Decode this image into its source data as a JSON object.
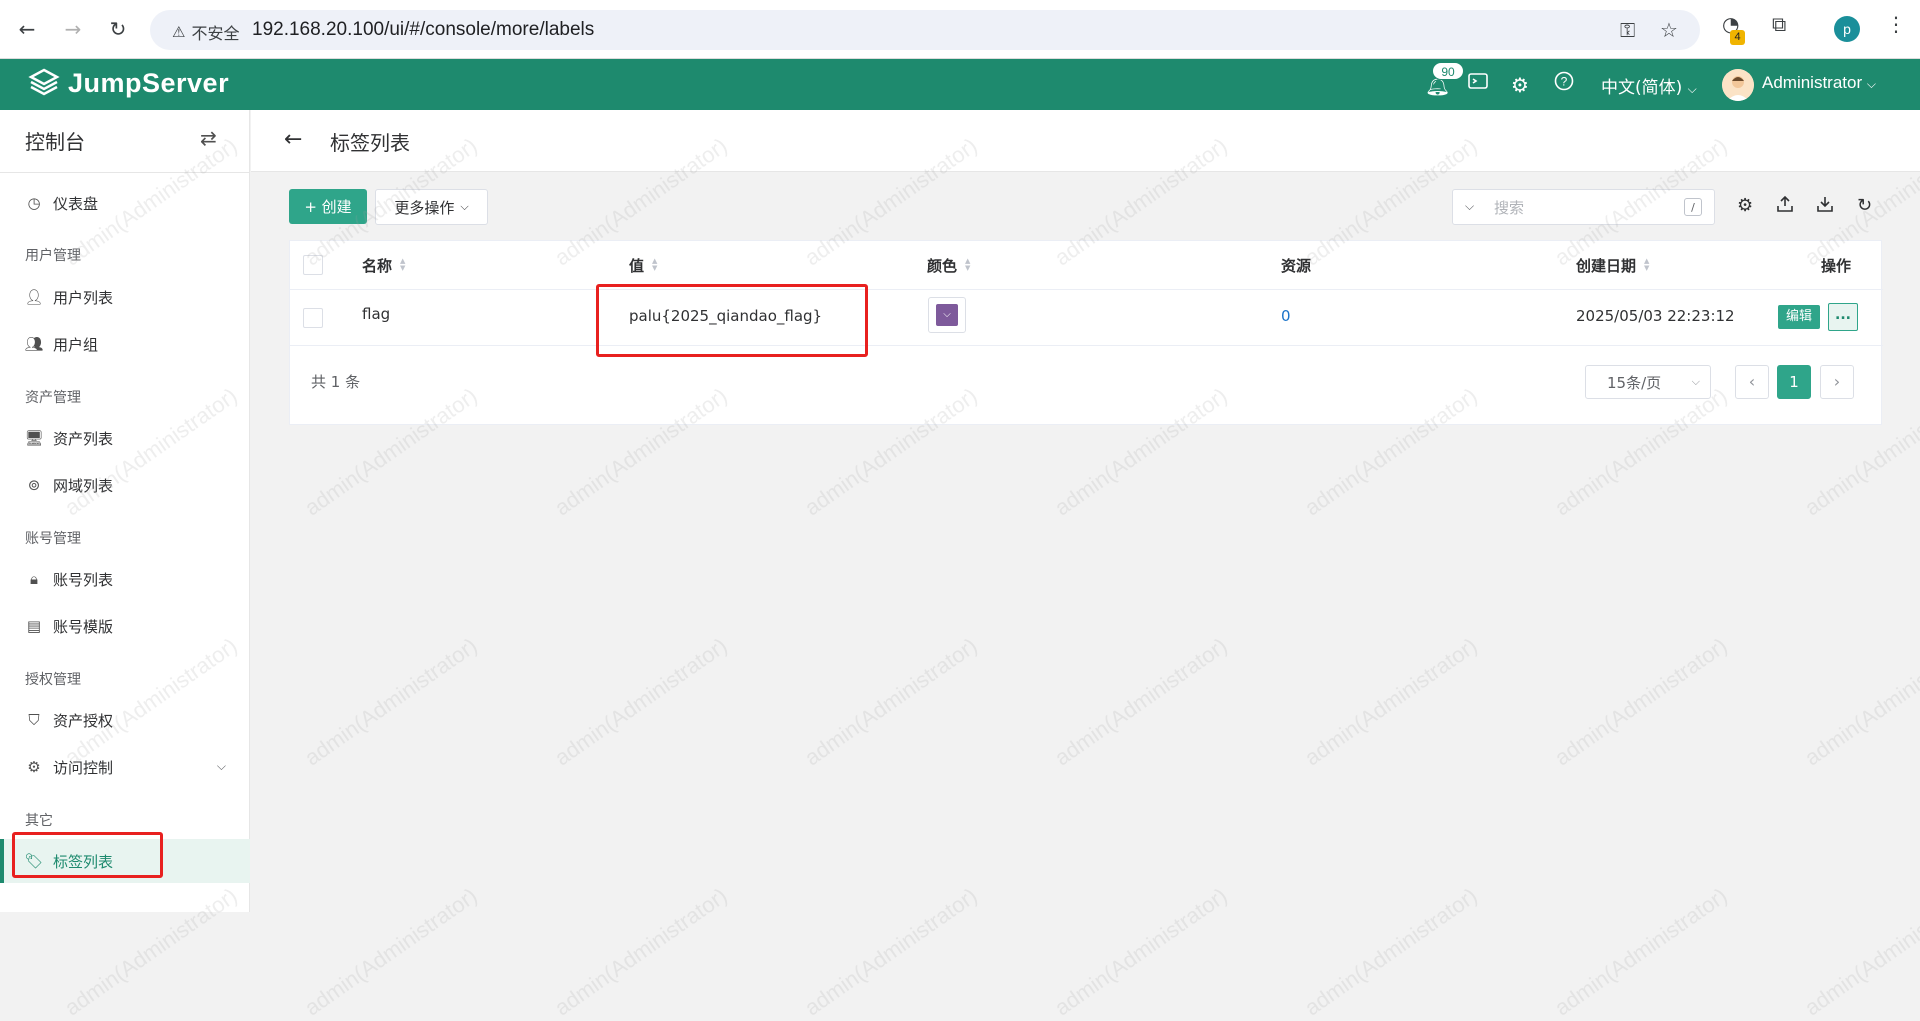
{
  "browser": {
    "security_label": "不安全",
    "url": "192.168.20.100/ui/#/console/more/labels",
    "extension_badge": "4",
    "profile_initial": "p"
  },
  "header": {
    "logo_text": "JumpServer",
    "notification_count": "90",
    "language": "中文(简体)",
    "user": "Administrator"
  },
  "sidebar": {
    "title": "控制台",
    "dashboard": "仪表盘",
    "groups": {
      "user_mgmt": "用户管理",
      "asset_mgmt": "资产管理",
      "account_mgmt": "账号管理",
      "perm_mgmt": "授权管理",
      "other": "其它"
    },
    "items": {
      "user_list": "用户列表",
      "user_group": "用户组",
      "asset_list": "资产列表",
      "zone_list": "网域列表",
      "account_list": "账号列表",
      "account_template": "账号模版",
      "asset_perm": "资产授权",
      "access_control": "访问控制",
      "label_list": "标签列表"
    }
  },
  "page": {
    "title": "标签列表"
  },
  "toolbar": {
    "create": "+ 创建",
    "more_actions": "更多操作",
    "search_placeholder": "搜索",
    "search_shortcut": "/"
  },
  "table": {
    "headers": {
      "name": "名称",
      "value": "值",
      "color": "颜色",
      "resources": "资源",
      "created": "创建日期",
      "actions": "操作"
    },
    "rows": [
      {
        "name": "flag",
        "value": "palu{2025_qiandao_flag}",
        "color": "#7e5a9b",
        "resources": "0",
        "created": "2025/05/03 22:23:12",
        "edit": "编辑",
        "more": "..."
      }
    ]
  },
  "pagination": {
    "total": "共 1 条",
    "page_size": "15条/页",
    "current_page": "1"
  },
  "watermark": "admin(Administrator)",
  "colors": {
    "brand": "#1e8a6e",
    "button": "#2fa58a",
    "highlight": "#e8201f"
  }
}
